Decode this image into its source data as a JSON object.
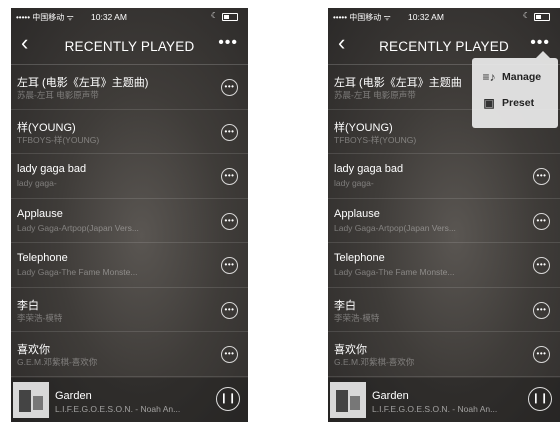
{
  "status": {
    "carrier": "••••• 中国移动 ᯤ",
    "time": "10:32 AM",
    "dnd": "☾"
  },
  "header": {
    "back": "‹",
    "title": "RECENTLY PLAYED",
    "more": "•••"
  },
  "songs": [
    {
      "name": "左耳 (电影《左耳》主题曲)",
      "artist": "苏晨-左耳 电影原声带"
    },
    {
      "name": "样(YOUNG)",
      "artist": "TFBOYS-样(YOUNG)"
    },
    {
      "name": "lady gaga bad",
      "artist": "lady gaga-"
    },
    {
      "name": "Applause",
      "artist": "Lady Gaga-Artpop(Japan Vers..."
    },
    {
      "name": "Telephone",
      "artist": "Lady Gaga-The Fame Monste..."
    },
    {
      "name": "李白",
      "artist": "李荣浩-模特"
    },
    {
      "name": "喜欢你",
      "artist": "G.E.M.邓紫棋-喜欢你"
    }
  ],
  "songs_right": [
    {
      "name": "左耳 (电影《左耳》主题曲",
      "artist": "苏晨-左耳 电影原声带"
    },
    {
      "name": "样(YOUNG)",
      "artist": "TFBOYS-样(YOUNG)"
    },
    {
      "name": "lady gaga bad",
      "artist": "lady gaga-"
    },
    {
      "name": "Applause",
      "artist": "Lady Gaga-Artpop(Japan Vers..."
    },
    {
      "name": "Telephone",
      "artist": "Lady Gaga-The Fame Monste..."
    },
    {
      "name": "李白",
      "artist": "李荣浩-模特"
    },
    {
      "name": "喜欢你",
      "artist": "G.E.M.邓紫棋-喜欢你"
    }
  ],
  "option_glyph": "•••",
  "now_playing": {
    "title": "Garden",
    "artist": "L.I.F.E.G.O.E.S.O.N. - Noah An...",
    "pause": "❙❙"
  },
  "menu": {
    "manage_icon": "≡♪",
    "manage": "Manage",
    "preset_icon": "▣",
    "preset": "Preset"
  }
}
